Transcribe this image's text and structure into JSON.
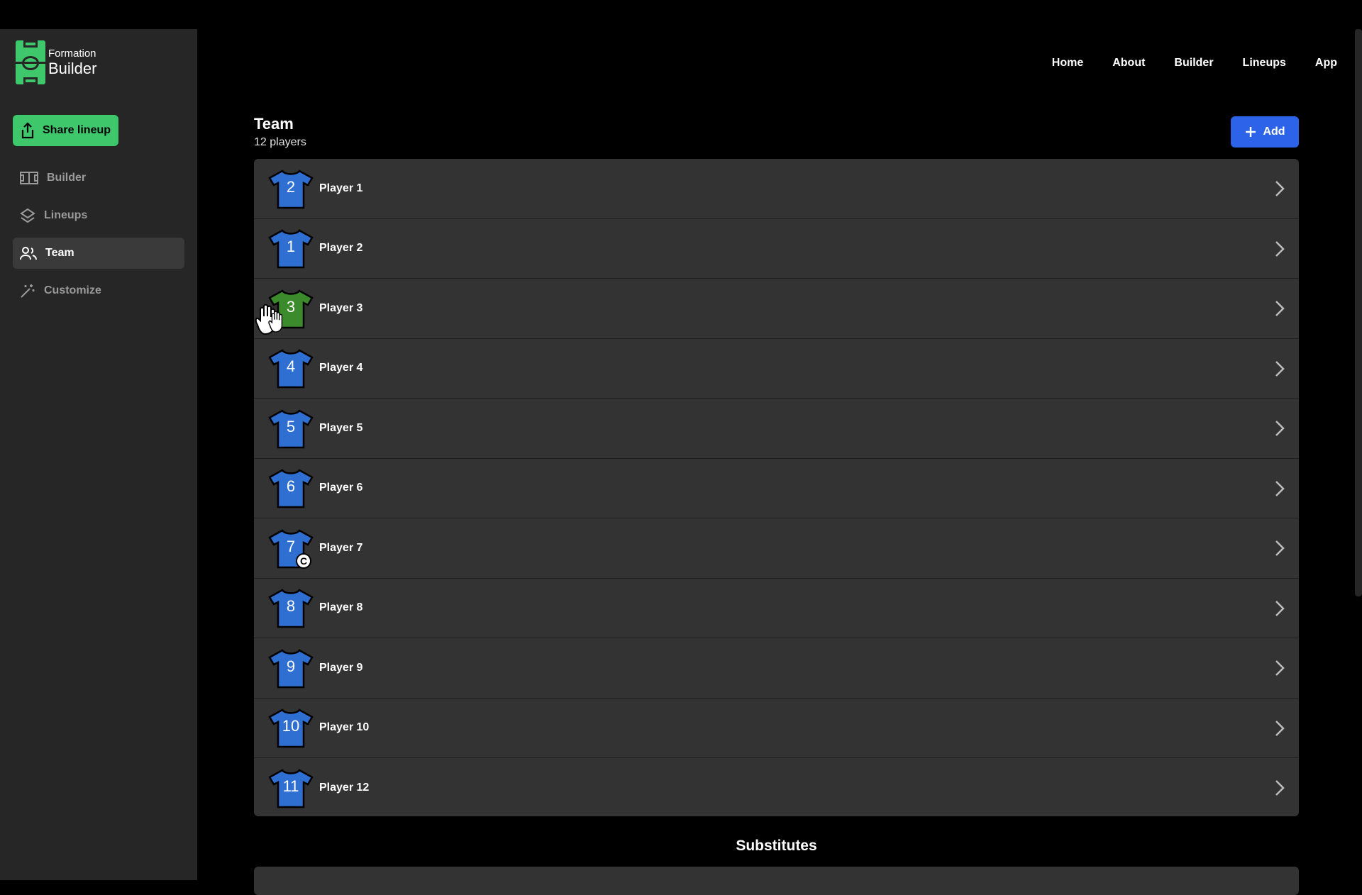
{
  "app": {
    "logo_line1": "Formation",
    "logo_line2": "Builder"
  },
  "sidebar": {
    "share_label": "Share lineup",
    "items": [
      {
        "label": "Builder",
        "icon": "field-icon",
        "active": false
      },
      {
        "label": "Lineups",
        "icon": "layers-icon",
        "active": false
      },
      {
        "label": "Team",
        "icon": "users-icon",
        "active": true
      },
      {
        "label": "Customize",
        "icon": "magic-wand-icon",
        "active": false
      }
    ]
  },
  "topnav": [
    "Home",
    "About",
    "Builder",
    "Lineups",
    "App"
  ],
  "team": {
    "title": "Team",
    "count": "12 players",
    "add_label": "Add",
    "players": [
      {
        "number": "2",
        "name": "Player 1",
        "color": "#2f6fd1",
        "captain": false
      },
      {
        "number": "1",
        "name": "Player 2",
        "color": "#2f6fd1",
        "captain": false
      },
      {
        "number": "3",
        "name": "Player 3",
        "color": "#3b8a2b",
        "captain": false
      },
      {
        "number": "4",
        "name": "Player 4",
        "color": "#2f6fd1",
        "captain": false
      },
      {
        "number": "5",
        "name": "Player 5",
        "color": "#2f6fd1",
        "captain": false
      },
      {
        "number": "6",
        "name": "Player 6",
        "color": "#2f6fd1",
        "captain": false
      },
      {
        "number": "7",
        "name": "Player 7",
        "color": "#2f6fd1",
        "captain": true,
        "captain_mark": "C"
      },
      {
        "number": "8",
        "name": "Player 8",
        "color": "#2f6fd1",
        "captain": false
      },
      {
        "number": "9",
        "name": "Player 9",
        "color": "#2f6fd1",
        "captain": false
      },
      {
        "number": "10",
        "name": "Player 10",
        "color": "#2f6fd1",
        "captain": false
      },
      {
        "number": "11",
        "name": "Player 12",
        "color": "#2f6fd1",
        "captain": false
      }
    ]
  },
  "substitutes": {
    "title": "Substitutes"
  },
  "colors": {
    "accent_green": "#3ec86b",
    "accent_blue": "#2c63e8"
  }
}
